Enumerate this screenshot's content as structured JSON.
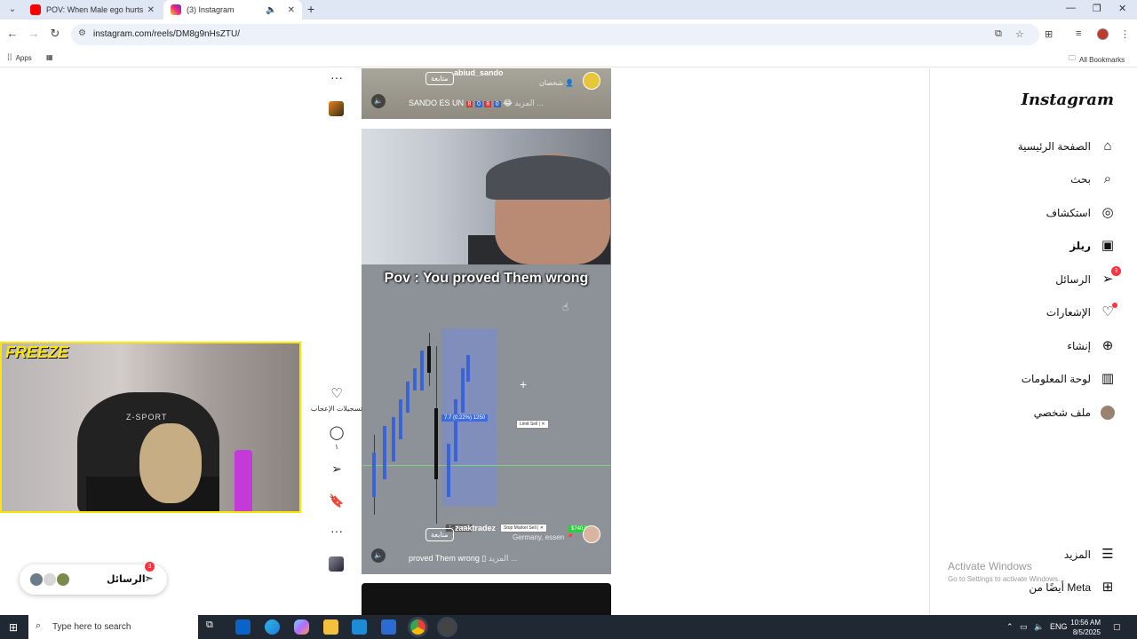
{
  "browser": {
    "tabs": [
      {
        "title": "POV: When Male ego hurts #m",
        "favicon_color": "#ff0000",
        "active": false
      },
      {
        "title": "(3) Instagram",
        "favicon_color": "#d6249f",
        "active": true
      }
    ],
    "active_tab_audio_icon": "speaker-icon",
    "url": "instagram.com/reels/DM8g9nHsZTU/",
    "bookmarks": {
      "apps": "Apps",
      "all": "All Bookmarks"
    }
  },
  "reels": {
    "top": {
      "username": "abiud_sando",
      "follow": "متابعة",
      "tag": "شخصان",
      "caption": "SANDO ES UN",
      "more": "المزيد ..."
    },
    "main": {
      "overlay_text": "Pov : You proved Them wrong",
      "username": "zaaktradez",
      "follow": "متابعة",
      "location": "Germany, essen",
      "caption": "proved Them wrong",
      "more": "المزيد ...",
      "chart": {
        "price_tag": "7.7 (0.22%) 1250",
        "limit_sell": "Limit Sell",
        "stop_market_sell": "Stop Market Sell",
        "stop_value": "7 - 32.460",
        "green_tag": "$740.00"
      }
    },
    "actions": {
      "likes_label": "تسجيلات الإعجاب",
      "comments_count": "١"
    }
  },
  "sidebar": {
    "logo": "Instagram",
    "items": [
      {
        "label": "الصفحة الرئيسية",
        "icon": "home-icon"
      },
      {
        "label": "بحث",
        "icon": "search-icon"
      },
      {
        "label": "استكشاف",
        "icon": "compass-icon"
      },
      {
        "label": "ريلز",
        "icon": "reels-icon"
      },
      {
        "label": "الرسائل",
        "icon": "messages-icon",
        "badge": "3"
      },
      {
        "label": "الإشعارات",
        "icon": "heart-icon"
      },
      {
        "label": "إنشاء",
        "icon": "plus-icon"
      },
      {
        "label": "لوحة المعلومات",
        "icon": "dashboard-icon"
      },
      {
        "label": "ملف شخصي",
        "icon": "profile-icon"
      }
    ],
    "more": "المزيد",
    "meta": "أيضًا من Meta"
  },
  "activate": {
    "title": "Activate Windows",
    "subtitle": "Go to Settings to activate Windows."
  },
  "webcam": {
    "overlay": "FREEZE",
    "chair_text": "Z-SPORT"
  },
  "messages_pill": {
    "label": "الرسائل",
    "badge": "3"
  },
  "taskbar": {
    "search_placeholder": "Type here to search",
    "language": "ENG",
    "time": "10:56 AM",
    "date": "8/5/2025"
  }
}
